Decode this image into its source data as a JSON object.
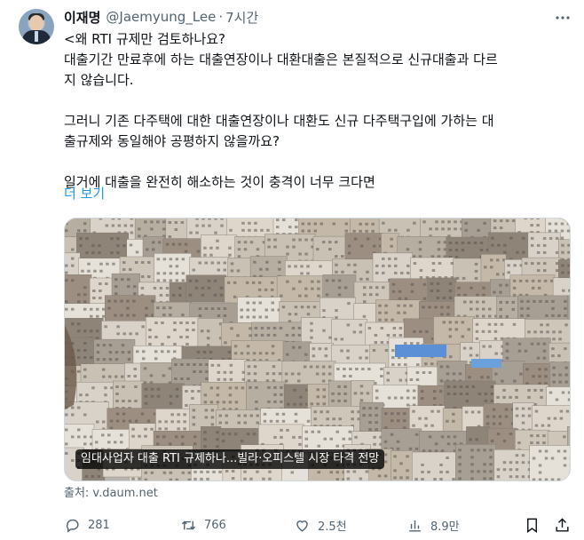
{
  "tweet": {
    "author_name": "이재명",
    "handle": "@Jaemyung_Lee",
    "separator": "·",
    "time": "7시간",
    "lines": [
      "<왜 RTI 규제만 검토하나요?",
      "대출기간 만료후에 하는 대출연장이나 대환대출은 본질적으로 신규대출과 다르",
      "지 않습니다.",
      "그러니 기존 다주택에 대한 대출연장이나 대환도 신규 다주택구입에 가하는 대",
      "출규제와 동일해야 공평하지 않을까요?",
      "일거에 대출을 완전히 해소하는 것이 충격이 너무 크다면"
    ],
    "show_more": "더 보기"
  },
  "card": {
    "image_icon": "city-buildings-photo",
    "caption": "임대사업자 대출 RTI 규제하나...빌라·오피스텔 시장 타격 전망",
    "source": "출처: v.daum.net"
  },
  "actions": {
    "replies": "281",
    "retweets": "766",
    "likes": "2.5천",
    "views": "8.9만"
  },
  "icons": [
    "avatar",
    "more-dots-icon",
    "reply-icon",
    "retweet-icon",
    "like-icon",
    "views-icon",
    "bookmark-icon",
    "share-icon"
  ]
}
